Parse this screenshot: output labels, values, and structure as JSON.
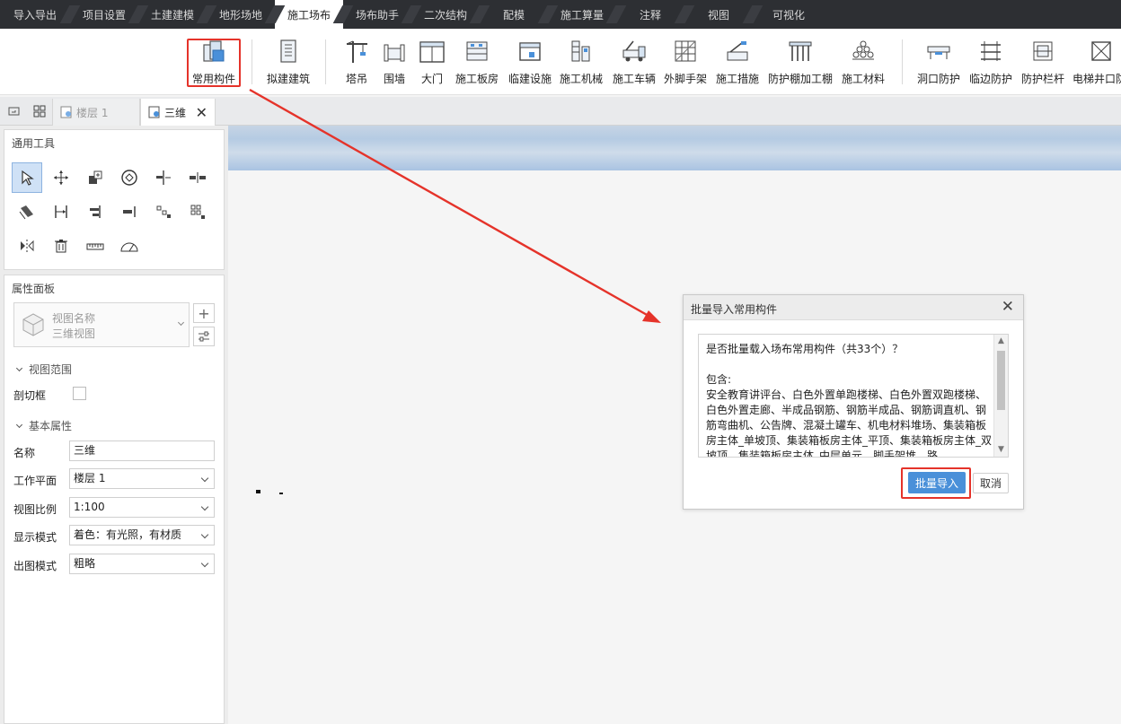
{
  "tabs": [
    {
      "label": "导入导出",
      "active": false
    },
    {
      "label": "项目设置",
      "active": false
    },
    {
      "label": "土建建模",
      "active": false
    },
    {
      "label": "地形场地",
      "active": false
    },
    {
      "label": "施工场布",
      "active": true
    },
    {
      "label": "场布助手",
      "active": false
    },
    {
      "label": "二次结构",
      "active": false
    },
    {
      "label": "配模",
      "active": false
    },
    {
      "label": "施工算量",
      "active": false
    },
    {
      "label": "注释",
      "active": false
    },
    {
      "label": "视图",
      "active": false
    },
    {
      "label": "可视化",
      "active": false
    }
  ],
  "ribbon": {
    "items": [
      {
        "label": "常用构件",
        "icon": "common-component-icon"
      },
      {
        "label": "拟建建筑",
        "icon": "proposed-building-icon"
      },
      {
        "label": "塔吊",
        "icon": "tower-crane-icon"
      },
      {
        "label": "围墙",
        "icon": "fence-wall-icon"
      },
      {
        "label": "大门",
        "icon": "gate-icon"
      },
      {
        "label": "施工板房",
        "icon": "board-house-icon"
      },
      {
        "label": "临建设施",
        "icon": "temporary-facility-icon"
      },
      {
        "label": "施工机械",
        "icon": "construction-machinery-icon"
      },
      {
        "label": "施工车辆",
        "icon": "construction-vehicle-icon"
      },
      {
        "label": "外脚手架",
        "icon": "scaffold-icon"
      },
      {
        "label": "施工措施",
        "icon": "construction-measure-icon"
      },
      {
        "label": "防护棚加工棚",
        "icon": "protection-shed-icon"
      },
      {
        "label": "施工材料",
        "icon": "construction-material-icon"
      },
      {
        "label": "洞口防护",
        "icon": "opening-protection-icon"
      },
      {
        "label": "临边防护",
        "icon": "edge-protection-icon"
      },
      {
        "label": "防护栏杆",
        "icon": "guardrail-icon"
      },
      {
        "label": "电梯井口防",
        "icon": "elevator-shaft-protection-icon"
      }
    ]
  },
  "view_tabs": {
    "floor": "楼层 1",
    "active": "三维"
  },
  "tools_panel": {
    "title": "通用工具"
  },
  "properties": {
    "title": "属性面板",
    "view_name_label": "视图名称",
    "view_name_value": "三维视图",
    "section_view_range": "视图范围",
    "clip_box_label": "剖切框",
    "clip_box_checked": false,
    "section_basic": "基本属性",
    "rows": [
      {
        "label": "名称",
        "value": "三维",
        "type": "text"
      },
      {
        "label": "工作平面",
        "value": "楼层 1",
        "type": "select"
      },
      {
        "label": "视图比例",
        "value": "1:100",
        "type": "select"
      },
      {
        "label": "显示模式",
        "value": "着色：有光照，有材质",
        "type": "select"
      },
      {
        "label": "出图模式",
        "value": "粗略",
        "type": "select"
      }
    ]
  },
  "dialog": {
    "title": "批量导入常用构件",
    "question": "是否批量载入场布常用构件（共33个）？",
    "contains_label": "包含:",
    "contents": "安全教育讲评台、白色外置单跑楼梯、白色外置双跑楼梯、白色外置走廊、半成品钢筋、钢筋半成品、钢筋调直机、钢筋弯曲机、公告牌、混凝土罐车、机电材料堆场、集装箱板房主体_单坡顶、集装箱板房主体_平顶、集装箱板房主体_双坡顶、集装箱板房主体_中层单元、脚手架堆、路",
    "confirm_label": "批量导入",
    "cancel_label": "取消"
  },
  "colors": {
    "tabbar_bg": "#2d2f33",
    "accent_blue": "#4a90d9",
    "highlight_red": "#e5332a"
  }
}
